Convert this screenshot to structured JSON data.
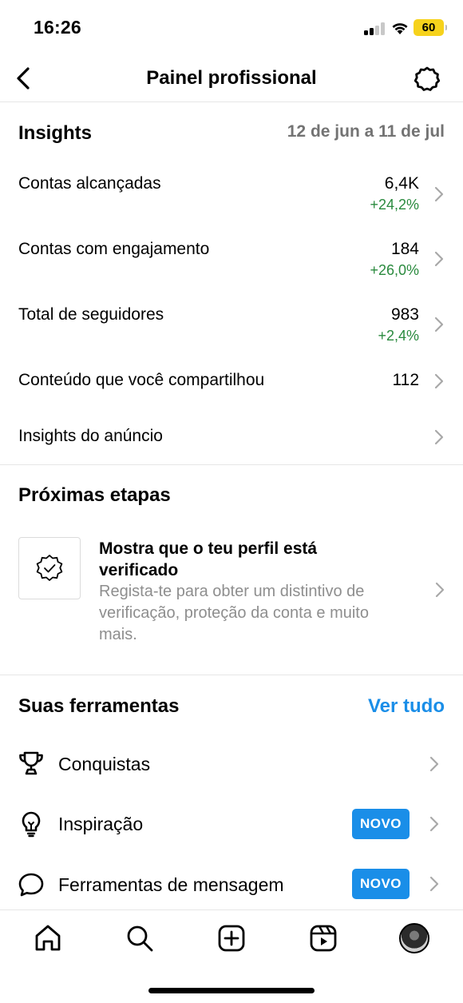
{
  "status_bar": {
    "time": "16:26",
    "battery": "60",
    "battery_color": "#f6d21c"
  },
  "nav": {
    "title": "Painel profissional"
  },
  "insights": {
    "title": "Insights",
    "date_range": "12 de jun a 11 de jul",
    "rows": [
      {
        "label": "Contas alcançadas",
        "value": "6,4K",
        "delta": "+24,2%"
      },
      {
        "label": "Contas com engajamento",
        "value": "184",
        "delta": "+26,0%"
      },
      {
        "label": "Total de seguidores",
        "value": "983",
        "delta": "+2,4%"
      },
      {
        "label": "Conteúdo que você compartilhou",
        "value": "112"
      },
      {
        "label": "Insights do anúncio"
      }
    ]
  },
  "next_steps": {
    "title": "Próximas etapas",
    "card_title": "Mostra que o teu perfil está verificado",
    "card_description": "Regista-te para obter um distintivo de verificação, proteção da conta e muito mais."
  },
  "tools": {
    "title": "Suas ferramentas",
    "see_all": "Ver tudo",
    "items": [
      {
        "label": "Conquistas",
        "icon": "trophy-icon"
      },
      {
        "label": "Inspiração",
        "icon": "lightbulb-icon",
        "badge": "NOVO"
      },
      {
        "label": "Ferramentas de mensagem",
        "icon": "message-bubble-icon",
        "badge": "NOVO"
      }
    ]
  },
  "colors": {
    "accent": "#1a8ee8",
    "positive": "#2a8a3e",
    "muted": "#737373"
  }
}
